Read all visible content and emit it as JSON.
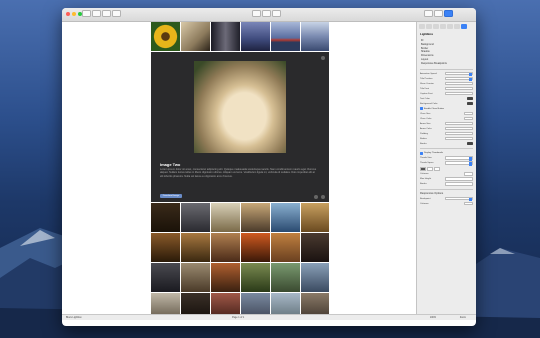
{
  "window": {
    "toolbar_left": [
      "Preview",
      "Pages",
      "Sections",
      "Layout"
    ],
    "toolbar_center": [
      "undo",
      "redo",
      "preview"
    ],
    "toolbar_right": [
      "Inspector"
    ]
  },
  "lightbox": {
    "title": "Image Two",
    "text": "Lorem ipsum dolor sit amet, consectetur adipiscing elit. Quisque malesuada scelerisque iaculis. Nam condimentum mauris eget rhoncus aliquet. Nullam luctus tellus in libero dignissim ultrices. Aliquam vel eros. Vestibulum ligula mi, vehicula id sodales. Duis imperdiet elit at elit lobortis pharetra. Nulla vel lacus eu dignissim arcu rhoncus.",
    "button_label": "Download Image"
  },
  "inspector": {
    "header": "LightBox",
    "list": [
      "ID",
      "Background",
      "Border",
      "Shadow",
      "Dimensions",
      "Layout",
      "Responsive Breakpoints"
    ],
    "rows": [
      "Animation Speed",
      "Title Position",
      "Show Counter",
      "Title Font",
      "Caption Font",
      "Text Color",
      "Background Color"
    ],
    "check_close": "Enable Close Button",
    "rows2": [
      "Close Size",
      "Close Color",
      "Arrow Size",
      "Arrow Color",
      "Padding",
      "Radius",
      "Border"
    ],
    "check_thumbs": "Display Thumbnails",
    "rows3": [
      "Thumb Size",
      "Thumb Space",
      "Alignment",
      "Columns",
      "Max Height",
      "Border"
    ],
    "footer_head": "Responsive Options",
    "footer_rows": [
      "Breakpoint",
      "Columns"
    ]
  },
  "statusbar": {
    "left": "Blocs Lightbox",
    "center": "Page 1 of 1",
    "right": "100%",
    "right2": "Zoom"
  },
  "colors": {
    "accent": "#3b82f6",
    "lightbox_bg": "#2a2a2c",
    "close_light": "#ff5f57",
    "min_light": "#febc2e",
    "max_light": "#28c840"
  },
  "tiles": {
    "strip": [
      "sunflower",
      "dog",
      "portrait",
      "dusk-boat",
      "boat-lake",
      "lake"
    ],
    "grid": [
      "dark-vehicle",
      "cars-night",
      "cathedral",
      "sunset-field",
      "coast-water",
      "grass-field",
      "rusty-car",
      "tv-room",
      "stage-crowd",
      "sunset-street",
      "arena",
      "dark-sky",
      "old-car",
      "pier",
      "sunset-boat",
      "tree-field",
      "country-road",
      "harbor",
      "kitchen",
      "dark-stairs",
      "red-car",
      "vehicle-outdoor",
      "small-house",
      "rocks",
      "old-computer",
      "volcano",
      "machine",
      "train-car",
      "old-building",
      "flower-field"
    ]
  }
}
